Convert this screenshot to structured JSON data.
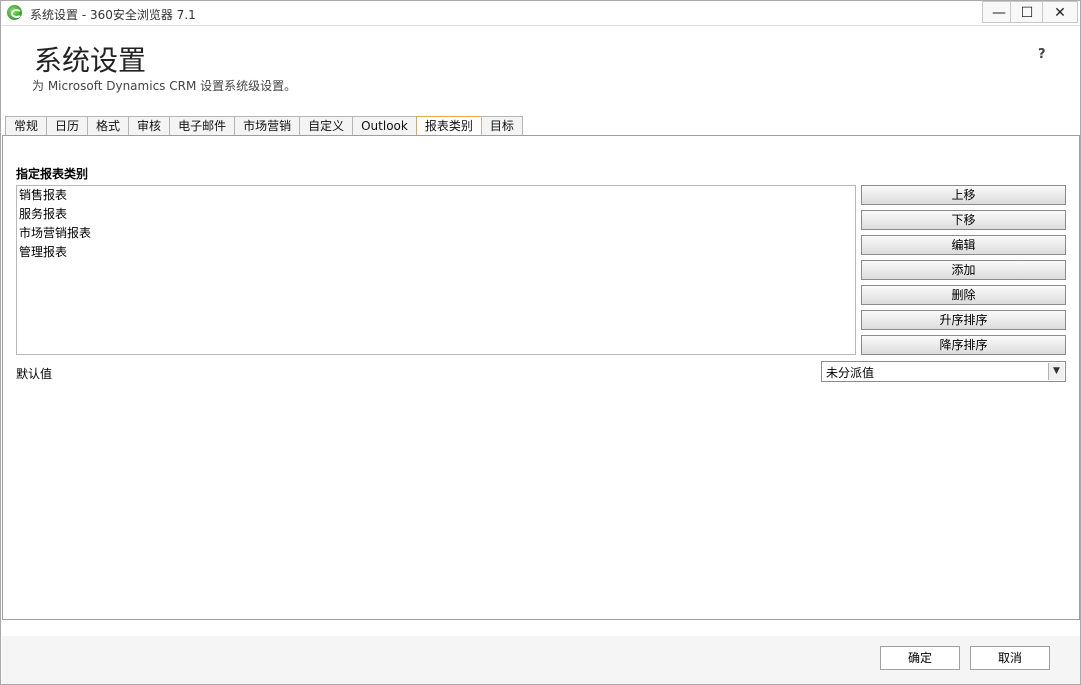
{
  "window": {
    "title": "系统设置 - 360安全浏览器 7.1"
  },
  "header": {
    "title": "系统设置",
    "subtitle": "为 Microsoft Dynamics CRM 设置系统级设置。",
    "help": "?"
  },
  "tabs": [
    {
      "label": "常规"
    },
    {
      "label": "日历"
    },
    {
      "label": "格式"
    },
    {
      "label": "审核"
    },
    {
      "label": "电子邮件"
    },
    {
      "label": "市场营销"
    },
    {
      "label": "自定义"
    },
    {
      "label": "Outlook"
    },
    {
      "label": "报表类别",
      "active": true
    },
    {
      "label": "目标"
    }
  ],
  "report_categories": {
    "section_label": "指定报表类别",
    "items": [
      "销售报表",
      "服务报表",
      "市场营销报表",
      "管理报表"
    ],
    "buttons": {
      "move_up": "上移",
      "move_down": "下移",
      "edit": "编辑",
      "add": "添加",
      "delete": "删除",
      "sort_asc": "升序排序",
      "sort_desc": "降序排序"
    },
    "default_label": "默认值",
    "default_value": "未分派值"
  },
  "footer": {
    "ok": "确定",
    "cancel": "取消"
  }
}
